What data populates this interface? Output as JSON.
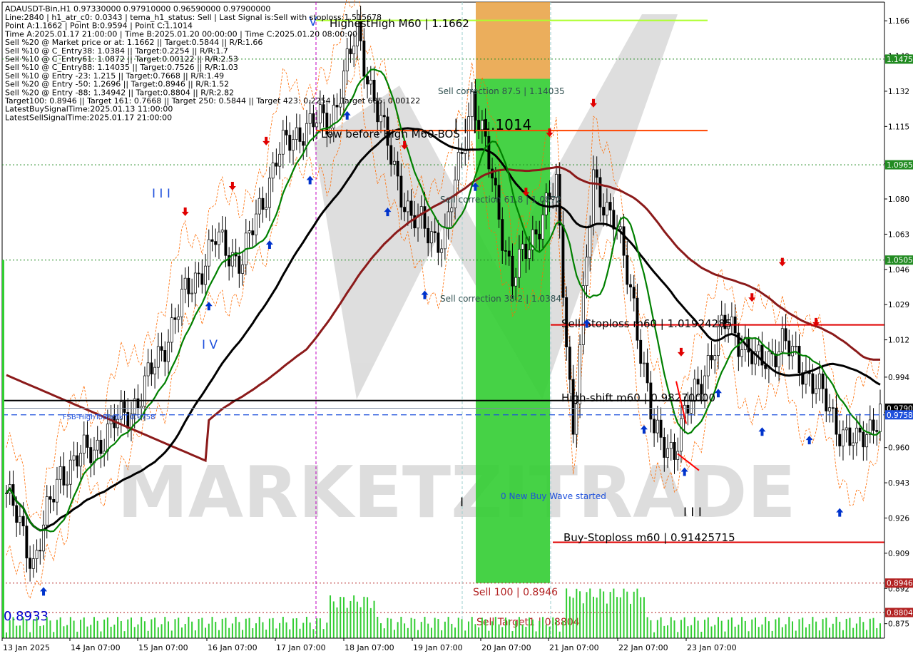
{
  "chart_data": {
    "type": "candlestick",
    "symbol": "ADAUSDT-Bin,H1",
    "ohlc": [
      "0.97330000",
      "0.97910000",
      "0.96590000",
      "0.97900000"
    ],
    "info_lines": [
      "Line:2840 | h1_atr_c0: 0.0343 | tema_h1_status: Sell | Last Signal is:Sell with stoploss:1.515678",
      "Point A:1.1662 | Point B:0.9594 | Point C:1.1014",
      "Time A:2025.01.17 21:00:00 | Time B:2025.01.20 00:00:00 | Time C:2025.01.20 08:00:00",
      "Sell %20 @ Market price or at: 1.1662 || Target:0.5844 || R/R:1.66",
      "Sell %10 @ C_Entry38: 1.0384 || Target:0.2254 || R/R:1.7",
      "Sell %10 @ C_Entry61: 1.0872 || Target:0.00122 || R/R:2.53",
      "Sell %10 @ C_Entry88: 1.14035 || Target:0.7526 || R/R:1.03",
      "Sell %10 @ Entry -23: 1.215 || Target:0.7668 || R/R:1.49",
      "Sell %20 @ Entry -50: 1.2696 || Target:0.8946 || R/R:1.52",
      "Sell %20 @ Entry -88: 1.34942 || Target:0.8804 || R/R:2.82",
      "Target100: 0.8946 || Target 161: 0.7668 || Target 250: 0.5844 || Target 423: 0.2254 || Target 685: 0.00122",
      "LatestBuySignalTime:2025.01.13 11:00:00",
      "LatestSellSignalTime:2025.01.17 21:00:00"
    ],
    "y_axis": {
      "min": 0.868,
      "max": 1.175,
      "ticks": [
        "1.166",
        "1.149",
        "1.132",
        "1.115",
        "1.097",
        "1.080",
        "1.063",
        "1.046",
        "1.029",
        "1.012",
        "0.994",
        "0.977",
        "0.960",
        "0.943",
        "0.926",
        "0.909",
        "0.892",
        "0.875"
      ]
    },
    "x_axis": {
      "labels": [
        "13 Jan 2025",
        "14 Jan 07:00",
        "15 Jan 07:00",
        "16 Jan 07:00",
        "17 Jan 07:00",
        "18 Jan 07:00",
        "19 Jan 07:00",
        "20 Jan 07:00",
        "21 Jan 07:00",
        "22 Jan 07:00",
        "23 Jan 07:00"
      ]
    },
    "price_tags": [
      {
        "label": "1.1475",
        "value": 1.1475,
        "color": "#228b22"
      },
      {
        "label": "1.0965",
        "value": 1.0965,
        "color": "#228b22"
      },
      {
        "label": "1.0505",
        "value": 1.0505,
        "color": "#228b22"
      },
      {
        "label": "0.9790",
        "value": 0.979,
        "color": "#000000"
      },
      {
        "label": "0.9758",
        "value": 0.9758,
        "color": "#1e50dc"
      },
      {
        "label": "0.8946",
        "value": 0.8946,
        "color": "#b22222"
      },
      {
        "label": "0.8804",
        "value": 0.8804,
        "color": "#b22222"
      }
    ],
    "levels": [
      {
        "label": "HighestHigh   M60 | 1.1662",
        "value": 1.1662,
        "color": "#adff2f"
      },
      {
        "label": "Low before High   M60-BOS",
        "value": 1.113,
        "color": "#ff4500"
      },
      {
        "label": "Sell-Stoploss m60 | 1.01924285",
        "value": 1.0192,
        "color": "#e00000"
      },
      {
        "label": "High-shift m60 | 0.98270000",
        "value": 0.9827,
        "color": "#000000"
      },
      {
        "label": "FSB-HighToBreak | 0.9758",
        "value": 0.9758,
        "color": "#1e50dc"
      },
      {
        "label": "Buy-Stoploss m60 | 0.91425715",
        "value": 0.9143,
        "color": "#e00000"
      },
      {
        "label": "Sell 100 | 0.8946",
        "value": 0.8946,
        "color": "#b22222"
      },
      {
        "label": "Sell Target1 | 0.8804",
        "value": 0.8804,
        "color": "#b22222"
      }
    ],
    "annotations": [
      {
        "text": "Sell correction 87.5 | 1.14035",
        "value": 1.14035
      },
      {
        "text": "Sell correction 61.8 | 1.0872",
        "value": 1.0872
      },
      {
        "text": "Sell correction 38.2 | 1.0384",
        "value": 1.0384
      },
      {
        "text": "0 New Buy Wave started",
        "value": 0.9475
      },
      {
        "text": "| | | 1.1014",
        "value": 1.1014
      },
      {
        "text": "0.8933",
        "value": 0.8933
      }
    ],
    "wave_labels": [
      "I I I",
      "I V",
      "V",
      "I",
      "I I I"
    ],
    "watermark": "MARKETZITRADE",
    "colors": {
      "ma_fast": "#008000",
      "ma_slow": "#000000",
      "ma_long": "#8b1a1a",
      "candle": "#000000",
      "volume": "#32cd32",
      "buy_zone": "#32cd32",
      "sell_zone": "#e8a040",
      "signal_up": "#0033cc",
      "signal_down": "#e00000"
    }
  }
}
